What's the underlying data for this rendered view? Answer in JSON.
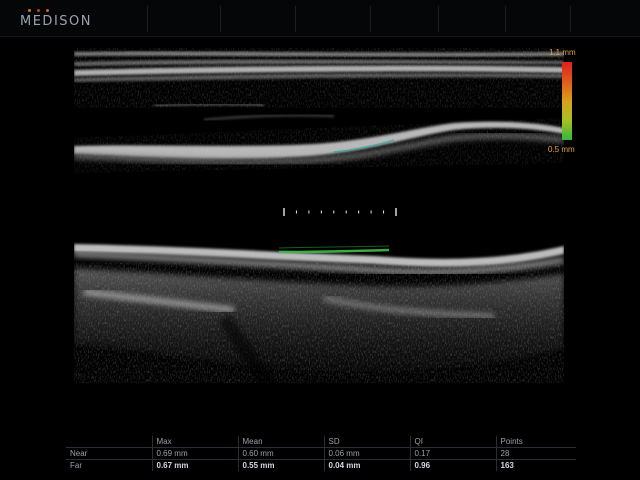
{
  "header": {
    "brand": "MEDISON",
    "dot_colors": [
      "#c77a2a",
      "#c43c2c",
      "#d0642a"
    ]
  },
  "scale": {
    "max_label": "1.1 mm",
    "min_label": "0.5 mm",
    "colors": [
      "#e02020",
      "#d8a01a",
      "#34b838"
    ]
  },
  "caliper": {
    "ticks": 10
  },
  "measurements": {
    "columns": [
      "",
      "Max",
      "Mean",
      "SD",
      "QI",
      "Points"
    ],
    "rows": [
      {
        "label": "Near",
        "max": "0.69 mm",
        "mean": "0.60 mm",
        "sd": "0.06 mm",
        "qi": "0.17",
        "points": "28"
      },
      {
        "label": "Far",
        "max": "0.67 mm",
        "mean": "0.55 mm",
        "sd": "0.04 mm",
        "qi": "0.96",
        "points": "163"
      }
    ]
  }
}
